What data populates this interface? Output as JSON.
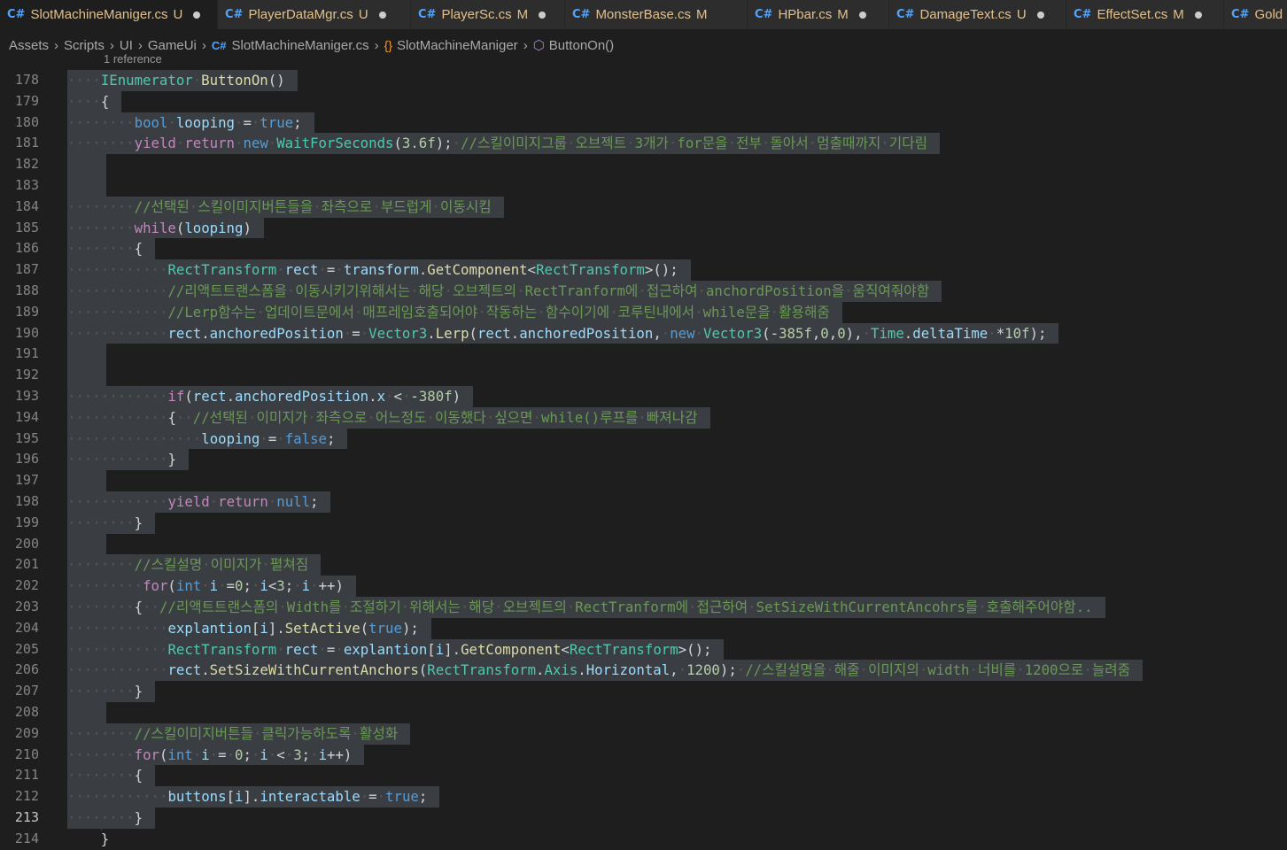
{
  "tabs": [
    {
      "name": "SlotMachineManiger.cs",
      "status": "U",
      "active": true
    },
    {
      "name": "PlayerDataMgr.cs",
      "status": "U",
      "active": false
    },
    {
      "name": "PlayerSc.cs",
      "status": "M",
      "active": false
    },
    {
      "name": "MonsterBase.cs",
      "status": "M",
      "active": false
    },
    {
      "name": "HPbar.cs",
      "status": "M",
      "active": false
    },
    {
      "name": "DamageText.cs",
      "status": "U",
      "active": false
    },
    {
      "name": "EffectSet.cs",
      "status": "M",
      "active": false
    },
    {
      "name": "Gold",
      "status": "",
      "active": false
    }
  ],
  "tab_icon": "C#",
  "breadcrumb": {
    "items": [
      "Assets",
      "Scripts",
      "UI",
      "GameUi"
    ],
    "file": "SlotMachineManiger.cs",
    "class": "SlotMachineManiger",
    "method": "ButtonOn()"
  },
  "codelens": "1 reference",
  "current_line": 213,
  "code_lines": [
    {
      "n": 178,
      "text": "IEnumerator ButtonOn()"
    },
    {
      "n": 179,
      "text": "{"
    },
    {
      "n": 180,
      "text": "bool looping = true;"
    },
    {
      "n": 181,
      "text": "yield return new WaitForSeconds(3.6f); //스킬이미지그룹 오브젝트 3개가 for문을 전부 돌아서 멈출때까지 기다림"
    },
    {
      "n": 182,
      "text": ""
    },
    {
      "n": 183,
      "text": ""
    },
    {
      "n": 184,
      "text": "//선택된 스킬이미지버튼들을 좌측으로 부드럽게 이동시킴"
    },
    {
      "n": 185,
      "text": "while(looping)"
    },
    {
      "n": 186,
      "text": "{"
    },
    {
      "n": 187,
      "text": "RectTransform rect = transform.GetComponent<RectTransform>();"
    },
    {
      "n": 188,
      "text": "//리액트트랜스폼을 이동시키기위해서는 해당 오브젝트의 RectTranform에 접근하여 anchordPosition을 움직여줘야함"
    },
    {
      "n": 189,
      "text": "//Lerp함수는 업데이트문에서 매프레임호출되어야 작동하는 함수이기에 코루틴내에서 while문을 활용해줌"
    },
    {
      "n": 190,
      "text": "rect.anchoredPosition = Vector3.Lerp(rect.anchoredPosition, new Vector3(-385f,0,0), Time.deltaTime *10f);"
    },
    {
      "n": 191,
      "text": ""
    },
    {
      "n": 192,
      "text": ""
    },
    {
      "n": 193,
      "text": "if(rect.anchoredPosition.x < -380f)"
    },
    {
      "n": 194,
      "text": "{  //선택된 이미지가 좌측으로 어느정도 이동했다 싶으면 while()루프를 빠져나감"
    },
    {
      "n": 195,
      "text": "looping = false;"
    },
    {
      "n": 196,
      "text": "}"
    },
    {
      "n": 197,
      "text": ""
    },
    {
      "n": 198,
      "text": "yield return null;"
    },
    {
      "n": 199,
      "text": "}"
    },
    {
      "n": 200,
      "text": ""
    },
    {
      "n": 201,
      "text": "//스킬설명 이미지가 펼쳐짐"
    },
    {
      "n": 202,
      "text": "for(int i =0; i<3; i ++)"
    },
    {
      "n": 203,
      "text": "{  //리액트트랜스폼의 Width를 조절하기 위해서는 해당 오브젝트의 RectTranform에 접근하여 SetSizeWithCurrentAncohrs를 호출해주어야함.."
    },
    {
      "n": 204,
      "text": "explantion[i].SetActive(true);"
    },
    {
      "n": 205,
      "text": "RectTransform rect = explantion[i].GetComponent<RectTransform>();"
    },
    {
      "n": 206,
      "text": "rect.SetSizeWithCurrentAnchors(RectTransform.Axis.Horizontal, 1200); //스킬설명을 해줄 이미지의 width 너비를 1200으로 늘려줌"
    },
    {
      "n": 207,
      "text": "}"
    },
    {
      "n": 208,
      "text": ""
    },
    {
      "n": 209,
      "text": "//스킬이미지버튼들 클릭가능하도록 활성화"
    },
    {
      "n": 210,
      "text": "for(int i = 0; i < 3; i++)"
    },
    {
      "n": 211,
      "text": "{"
    },
    {
      "n": 212,
      "text": "buttons[i].interactable = true;"
    },
    {
      "n": 213,
      "text": "}"
    },
    {
      "n": 214,
      "text": "}"
    }
  ]
}
